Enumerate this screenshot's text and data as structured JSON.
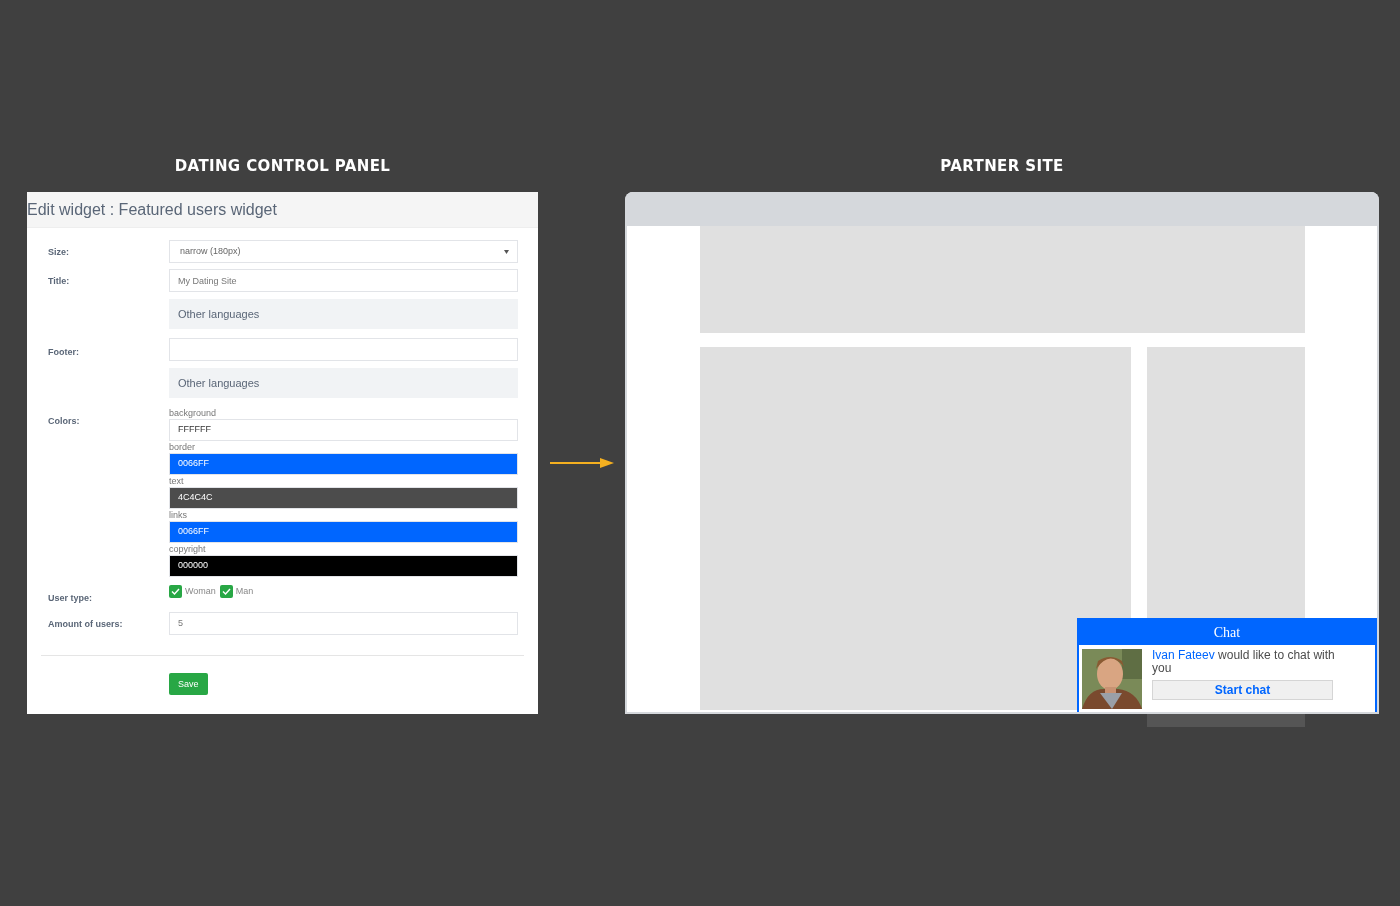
{
  "control_panel": {
    "caption": "DATING CONTROL PANEL",
    "title": "Edit widget : Featured users widget",
    "size": {
      "label": "Size:",
      "value": "narrow (180px)"
    },
    "title_field": {
      "label": "Title:",
      "placeholder": "My Dating Site",
      "languages": "Other languages"
    },
    "footer_field": {
      "label": "Footer:",
      "languages": "Other languages"
    },
    "colors": {
      "label": "Colors:",
      "items": [
        {
          "name": "background",
          "value": "FFFFFF",
          "color": "#ffffff"
        },
        {
          "name": "border",
          "value": "0066FF",
          "color": "#0066ff"
        },
        {
          "name": "text",
          "value": "4C4C4C",
          "color": "#4c4c4c"
        },
        {
          "name": "links",
          "value": "0066FF",
          "color": "#0066ff"
        },
        {
          "name": "copyright",
          "value": "000000",
          "color": "#000000"
        }
      ]
    },
    "user_type": {
      "label": "User type:",
      "options": [
        {
          "label": "Woman",
          "checked": true
        },
        {
          "label": "Man",
          "checked": true
        }
      ]
    },
    "amount": {
      "label": "Amount of users:",
      "placeholder": "5"
    },
    "save": "Save"
  },
  "partner_site": {
    "caption": "PARTNER SITE",
    "chat": {
      "title": "Chat",
      "user": "Ivan Fateev",
      "message": "would like to chat with you",
      "button": "Start chat"
    }
  }
}
